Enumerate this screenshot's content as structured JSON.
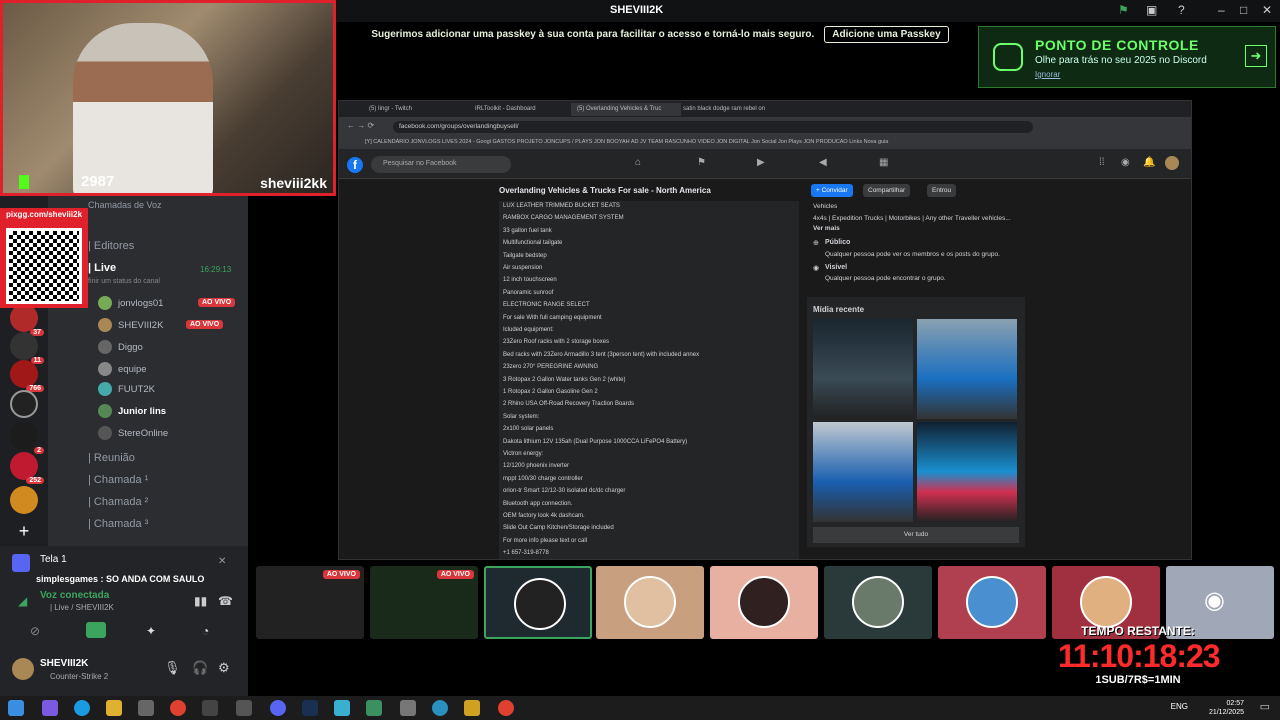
{
  "topbar": {
    "title": "SHEVIII2K"
  },
  "banner": {
    "text": "Sugerimos adicionar uma passkey à sua conta para facilitar o acesso e torná-lo mais seguro.",
    "button": "Adicione uma Passkey"
  },
  "checkpoint": {
    "title": "PONTO DE CONTROLE",
    "subtitle": "Olhe para trás no seu 2025 no Discord",
    "link": "Ignorar"
  },
  "webcam": {
    "viewers": "2987",
    "handle": "sheviii2kk"
  },
  "qr": {
    "label": "pixgg.com/sheviii2k"
  },
  "sidebar": {
    "voice_header": "Chamadas de Voz",
    "channels": [
      {
        "label": "| Editores"
      },
      {
        "label": "| Live"
      }
    ],
    "live_time": "16:29:13",
    "status_hint": "finir um status do canal",
    "users": [
      "jonvlogs01",
      "SHEVIII2K",
      "Diggo",
      "equipe",
      "FUUT2K",
      "Junior lins",
      "StereOnline"
    ],
    "live_badge": "AO VIVO",
    "more_channels": [
      "| Reunião",
      "| Chamada ¹",
      "| Chamada ²",
      "| Chamada ³"
    ],
    "server_badges": [
      "37",
      "11",
      "766",
      "2",
      "252"
    ]
  },
  "panel": {
    "screen": "Tela 1",
    "message": "simplesgames : SO ANDA COM SAULO",
    "voice_status": "Voz conectada",
    "voice_channel": "| Live / SHEVIII2K",
    "username": "SHEVIII2K",
    "game": "Counter-Strike 2"
  },
  "browser": {
    "tabs": [
      "(5) Iingr - Twitch",
      "IRLToolkit - Dashboard",
      "(5) Overlanding Vehicles & Truc",
      "satin black dodge ram rebel on"
    ],
    "url": "facebook.com/groups/overlandingbuysell/",
    "bookmarks": "[Y] CALENDÁRIO  JONVLOGS  LIVES 2024 - Googl  GASTOS PROJETO  JONCUPS / PLAYS  JON BOOYAH AD  JV TEAM  RASCUNHO VIDEO  JON DIGITAL  Jon Social  Jon Plays  JON PRODUCAO  Links  Nova guia",
    "search_placeholder": "Pesquisar no Facebook",
    "group_name": "Overlanding Vehicles & Trucks For sale - North America",
    "btn_invite": "+ Convidar",
    "btn_share": "Compartilhar",
    "btn_joined": "Entrou",
    "post_lines": [
      "LUX LEATHER TRIMMED BUCKET SEATS",
      "RAMBOX CARGO MANAGEMENT SYSTEM",
      "33 gallon fuel tank",
      "Multifunctional tailgate",
      "Tailgate bedstep",
      "Air suspension",
      "12 inch touchscreen",
      "Panoramic sunroof",
      "ELECTRONIC RANGE SELECT",
      "For sale With full camping equipment",
      "Icluded equipment:",
      "23Zero Roof racks with 2 storage boxes",
      "Bed racks with 23Zero Armadillo 3 tent (3person tent) with included annex",
      "23zero 270° PEREGRINE AWNING",
      "3 Rotopax 2 Gallon Water tanks Gen 2 (white)",
      "1 Rotopax 2 Gallon Gasoline Gen 2",
      "2 Rhino USA Off-Road Recovery Traction Boards",
      "Solar system:",
      "2x100 solar panels",
      "Dakota lithium 12V 135ah (Dual Purpose 1000CCA LiFePO4 Battery)",
      "Victron energy:",
      "12/1200 phoenix inverter",
      "mppt 100/30 charge controller",
      "orion-tr Smart 12/12-30 isolated dc/dc charger",
      "Bluetooth app connection.",
      "OEM factory look 4k dashcam.",
      "Slide Out Camp Kitchen/Storage included",
      "For more info please text or call",
      "+1 657-319-8778"
    ],
    "about_vehicles": "Vehicles",
    "about_desc": "4x4s | Expedition Trucks | Motorbikes | Any other Traveller vehicles...",
    "about_more": "Ver mais",
    "public_title": "Público",
    "public_desc": "Qualquer pessoa pode ver os membros e os posts do grupo.",
    "visible_title": "Visível",
    "visible_desc": "Qualquer pessoa pode encontrar o grupo.",
    "media_title": "Mídia recente",
    "see_all": "Ver tudo"
  },
  "tiles": {
    "live_badge": "AO VIVO"
  },
  "timer": {
    "label": "TEMPO RESTANTE:",
    "value": "11:10:18:23",
    "rate": "1SUB/7R$=1MIN"
  },
  "taskbar": {
    "lang": "ENG",
    "time": "02:57",
    "date": "21/12/2025"
  }
}
